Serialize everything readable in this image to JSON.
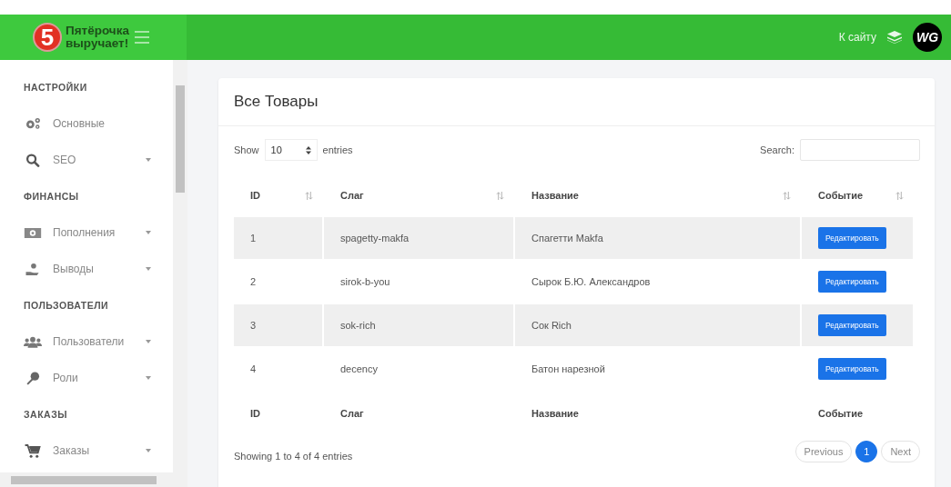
{
  "header": {
    "logo": {
      "mark": "5",
      "line_1": "Пятёрочка",
      "line_2": "выручает!"
    },
    "site_link": "К сайту",
    "avatar": "WG"
  },
  "sidebar": {
    "sections": [
      {
        "title": "НАСТРОЙКИ",
        "items": [
          {
            "label": "Основные",
            "expandable": false
          },
          {
            "label": "SEO",
            "expandable": true
          }
        ]
      },
      {
        "title": "ФИНАНСЫ",
        "items": [
          {
            "label": "Пополнения",
            "expandable": true
          },
          {
            "label": "Выводы",
            "expandable": true
          }
        ]
      },
      {
        "title": "ПОЛЬЗОВАТЕЛИ",
        "items": [
          {
            "label": "Пользователи",
            "expandable": true
          },
          {
            "label": "Роли",
            "expandable": true
          }
        ]
      },
      {
        "title": "ЗАКАЗЫ",
        "items": [
          {
            "label": "Заказы",
            "expandable": true
          }
        ]
      }
    ]
  },
  "card": {
    "title": "Все Товары",
    "length_label_1": "Show",
    "length_value": "10",
    "length_label_2": "entries",
    "search_label": "Search:",
    "table": {
      "columns": [
        {
          "label": "ID",
          "sortable": true
        },
        {
          "label": "Слаг",
          "sortable": true
        },
        {
          "label": "Название",
          "sortable": true
        },
        {
          "label": "Событие",
          "sortable": true
        }
      ],
      "rows": [
        {
          "id": "1",
          "slug": "spagetty-makfa",
          "name": "Спагетти Makfa",
          "action": "Редактировать"
        },
        {
          "id": "2",
          "slug": "sirok-b-you",
          "name": "Сырок Б.Ю. Александров",
          "action": "Редактировать"
        },
        {
          "id": "3",
          "slug": "sok-rich",
          "name": "Сок Rich",
          "action": "Редактировать"
        },
        {
          "id": "4",
          "slug": "decency",
          "name": "Батон нарезной",
          "action": "Редактировать"
        }
      ],
      "footer": [
        "ID",
        "Слаг",
        "Название",
        "Событие"
      ]
    },
    "info": "Showing 1 to 4 of 4 entries",
    "pagination": [
      {
        "label": "Previous",
        "selected": false
      },
      {
        "label": "1",
        "selected": true
      },
      {
        "label": "Next",
        "selected": false
      }
    ]
  }
}
